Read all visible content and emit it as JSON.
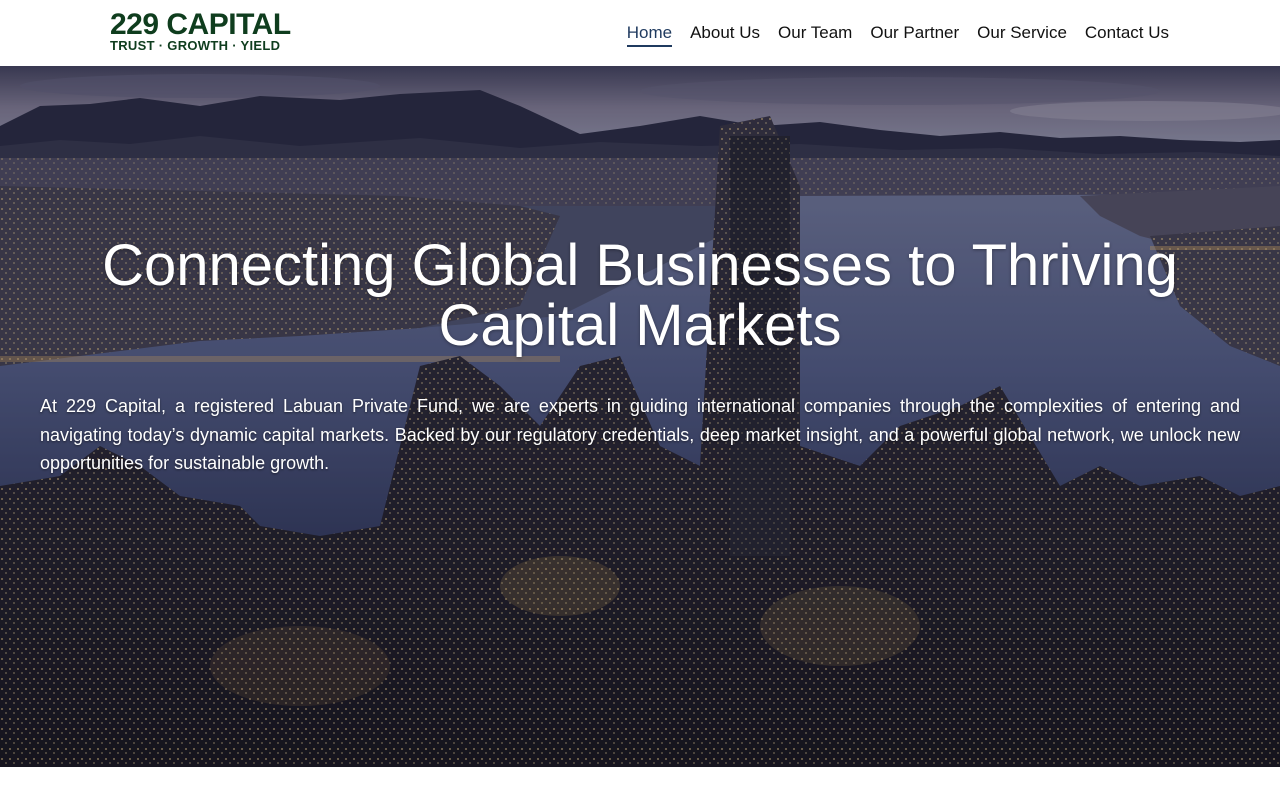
{
  "brand": {
    "name": "229 CAPITAL",
    "tagline": "TRUST · GROWTH · YIELD",
    "color": "#0f3d1e"
  },
  "nav": {
    "items": [
      {
        "label": "Home",
        "active": true
      },
      {
        "label": "About Us",
        "active": false
      },
      {
        "label": "Our Team",
        "active": false
      },
      {
        "label": "Our Partner",
        "active": false
      },
      {
        "label": "Our Service",
        "active": false
      },
      {
        "label": "Contact Us",
        "active": false
      }
    ],
    "active_color": "#1f3a5f"
  },
  "hero": {
    "title": "Connecting Global Businesses to Thriving Capital Markets",
    "body": "At 229 Capital, a registered Labuan Private Fund, we are experts in guiding international companies through the complexities of entering and navigating today’s dynamic capital markets. Backed by our regulatory credentials, deep market insight, and a powerful global network, we unlock new opportunities for sustainable growth.",
    "background": "city-skyline-harbor-dusk-photo"
  }
}
